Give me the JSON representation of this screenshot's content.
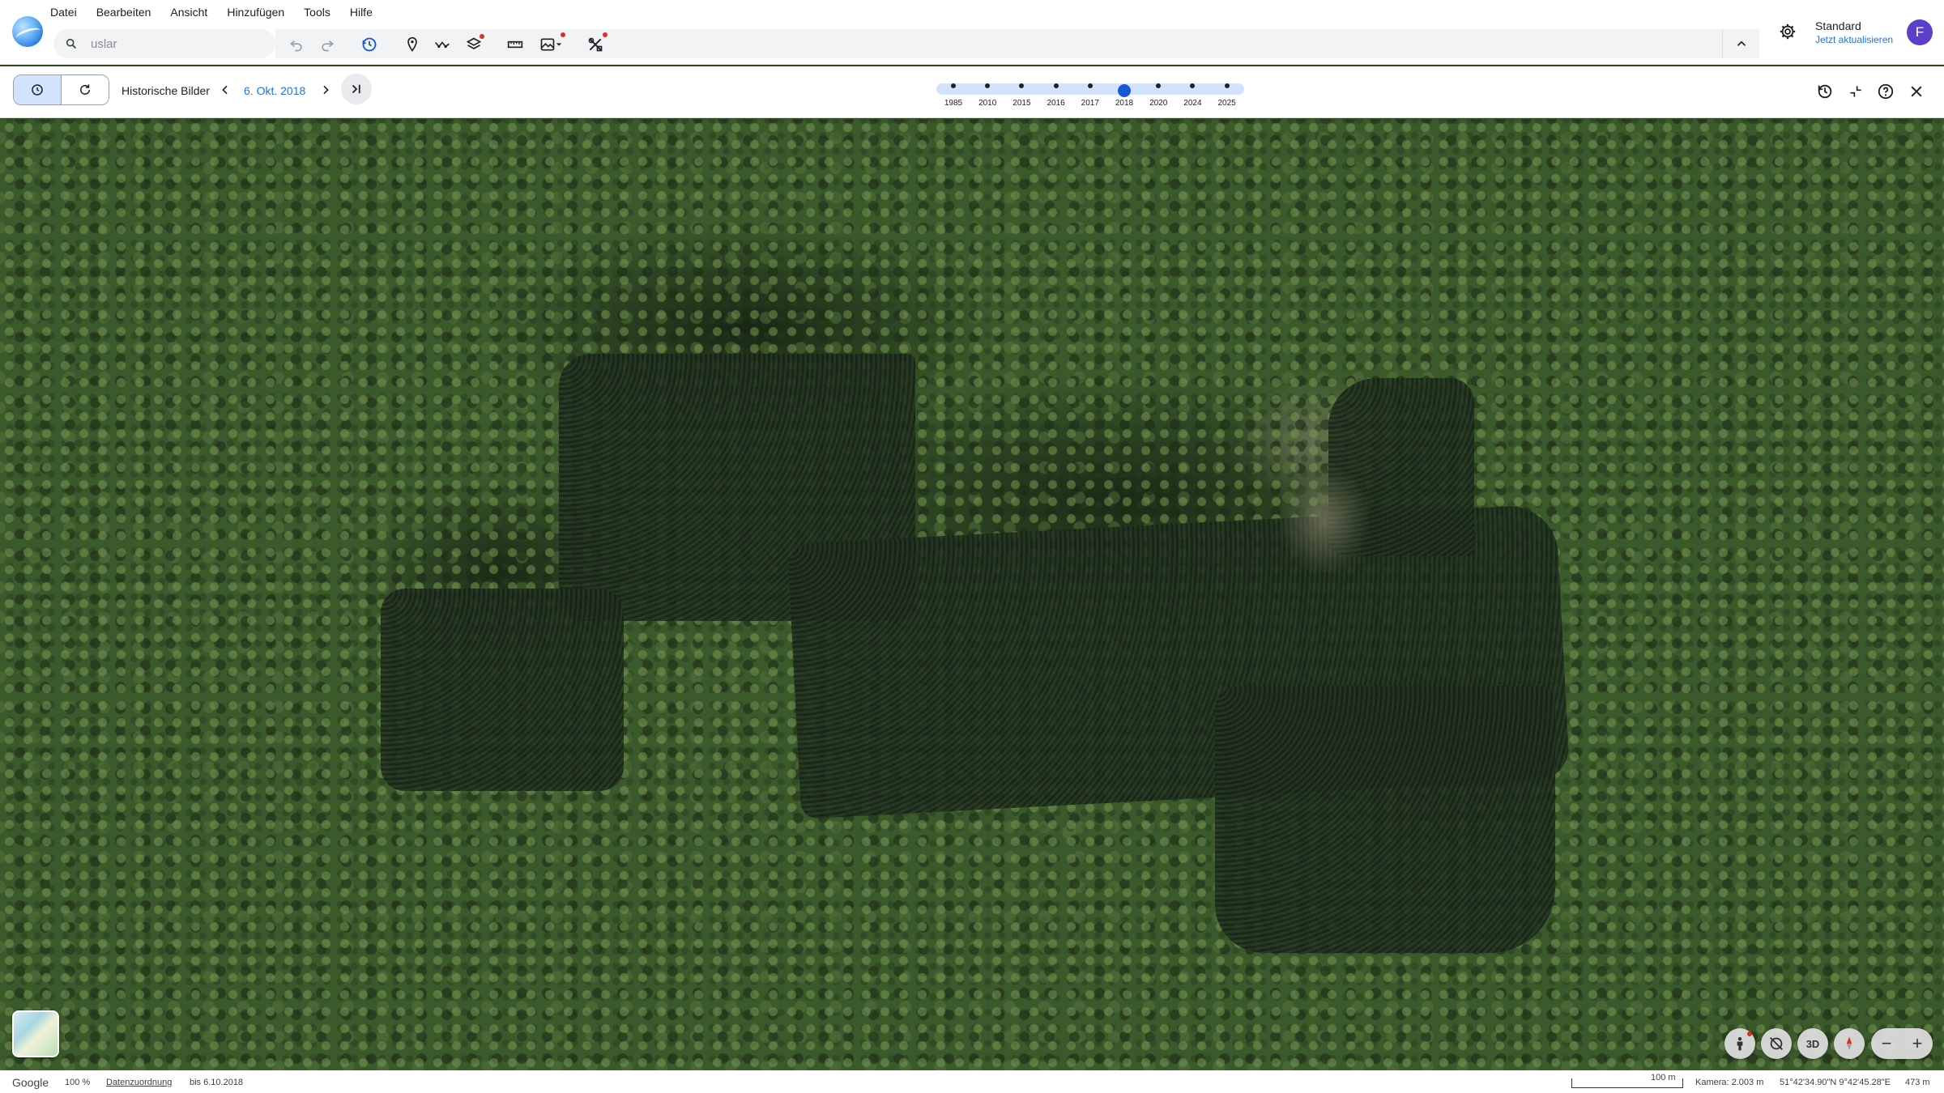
{
  "menu": [
    "Datei",
    "Bearbeiten",
    "Ansicht",
    "Hinzufügen",
    "Tools",
    "Hilfe"
  ],
  "search": {
    "value": "",
    "placeholder": "uslar"
  },
  "toolbar": {
    "icons": [
      "undo-icon",
      "redo-icon",
      "historical-imagery-icon",
      "placemark-icon",
      "path-icon",
      "layers-icon",
      "ruler-icon",
      "image-overlay-icon",
      "settings-tool-icon"
    ]
  },
  "profile": {
    "name": "Standard",
    "update_label": "Jetzt aktualisieren",
    "avatar_letter": "F"
  },
  "historical": {
    "label": "Historische Bilder",
    "date": "6. Okt. 2018",
    "years": [
      "1985",
      "2010",
      "2015",
      "2016",
      "2017",
      "2018",
      "2020",
      "2024",
      "2025"
    ],
    "selected_year": "2018"
  },
  "map_controls": {
    "three_d": "3D"
  },
  "status": {
    "google": "Google",
    "zoom": "100 %",
    "attribution": "Datenzuordnung",
    "imagery_date": "bis 6.10.2018",
    "scale": "100 m",
    "camera": "Kamera: 2.003 m",
    "coords": "51°42'34.90\"N 9°42'45.28\"E",
    "elevation": "473 m"
  },
  "colors": {
    "accent": "#1a73e8",
    "timeline_selected": "#1a57d6",
    "timeline_track": "#d3e3fd",
    "avatar": "#5c3fc9"
  }
}
